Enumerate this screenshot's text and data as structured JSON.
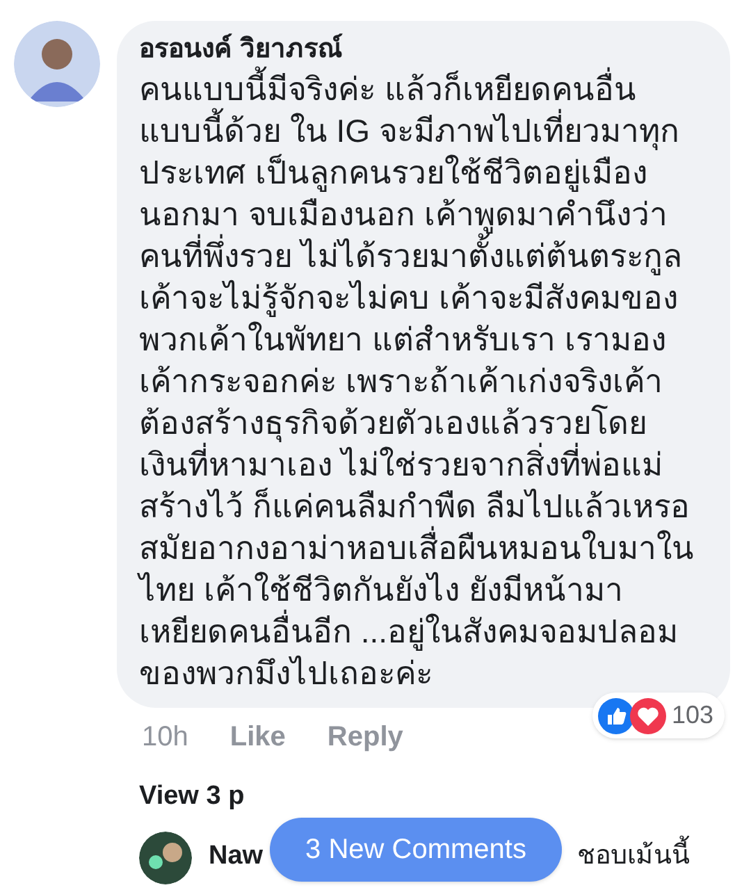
{
  "comment": {
    "author": "อรอนงค์ วิยาภรณ์",
    "lines": [
      "คนแบบนี้มีจริงค่ะ แล้วก็เหยียดคนอื่น",
      "แบบนี้ด้วย ใน IG จะมีภาพไปเที่ยวมาทุก",
      "ประเทศ เป็นลูกคนรวยใช้ชีวิตอยู่เมือง",
      "นอกมา จบเมืองนอก เค้าพูดมาคำนึงว่า",
      "คนที่พึ่งรวย ไม่ได้รวยมาตั้งแต่ต้นตระกูล",
      "เค้าจะไม่รู้จักจะไม่คบ เค้าจะมีสังคมของ",
      "พวกเค้าในพัทยา แต่สำหรับเรา เรามอง",
      "เค้ากระจอกค่ะ เพราะถ้าเค้าเก่งจริงเค้า",
      "ต้องสร้างธุรกิจด้วยตัวเองแล้วรวยโดย",
      "เงินที่หามาเอง ไม่ใช่รวยจากสิ่งที่พ่อแม่",
      "สร้างไว้ ก็แค่คนลืมกำพืด ลืมไปแล้วเหรอ",
      "สมัยอากงอาม่าหอบเสื่อผืนหมอนใบมาใน",
      "ไทย เค้าใช้ชีวิตกันยังไง ยังมีหน้ามา",
      "เหยียดคนอื่นอีก ...อยู่ในสังคมจอมปลอม",
      "ของพวกมึงไปเถอะค่ะ"
    ],
    "time": "10h",
    "actions": [
      "Like",
      "Reply"
    ],
    "reaction_count": "103"
  },
  "view_replies": "View 3 p",
  "new_comments_button": "3 New Comments",
  "reply": {
    "author": "Naw",
    "text": "ชอบเม้นนี้"
  }
}
